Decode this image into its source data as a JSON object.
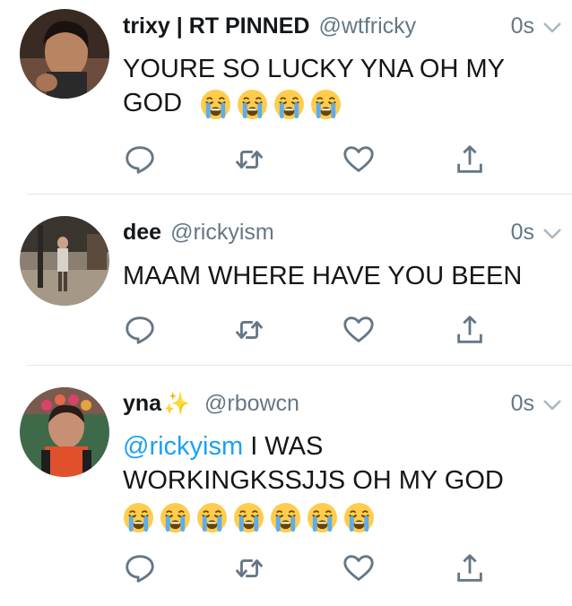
{
  "colors": {
    "link": "#1da1f2",
    "secondary": "#657786",
    "divider": "#e1e8ed"
  },
  "tweets": [
    {
      "name": "trixy | RT PINNED",
      "handle": "@wtfricky",
      "time": "0s",
      "text": "YOURE SO LUCKY YNA OH MY GOD",
      "emoji": [
        "loudly-crying-face",
        "loudly-crying-face",
        "loudly-crying-face",
        "loudly-crying-face"
      ]
    },
    {
      "name": "dee",
      "handle": "@rickyism",
      "time": "0s",
      "text": "MAAM WHERE HAVE YOU BEEN",
      "emoji": []
    },
    {
      "name": "yna",
      "name_emoji": "sparkles",
      "handle": "@rbowcn",
      "time": "0s",
      "mention": "@rickyism",
      "text_line1": " I WAS",
      "text_line2": "WORKINGKSSJJS OH MY GOD",
      "emoji": [
        "loudly-crying-face",
        "loudly-crying-face",
        "loudly-crying-face",
        "loudly-crying-face",
        "loudly-crying-face",
        "loudly-crying-face",
        "loudly-crying-face"
      ]
    }
  ],
  "icons": {
    "reply": "reply-bubble-icon",
    "retweet": "retweet-icon",
    "like": "heart-icon",
    "share": "share-upload-icon",
    "caret": "chevron-down-icon"
  }
}
